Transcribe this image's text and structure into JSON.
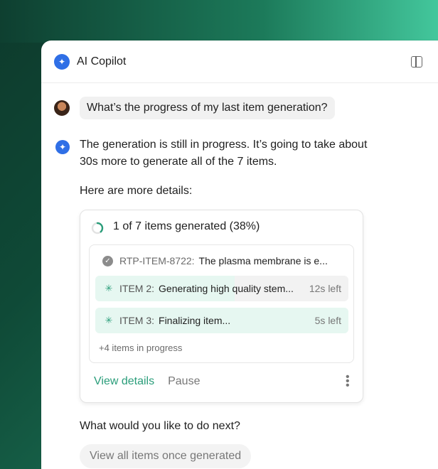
{
  "header": {
    "title": "AI Copilot",
    "icons": {
      "brand": "sparkle-icon",
      "panel": "sidebar-toggle-icon",
      "close": "close-icon"
    }
  },
  "user_message": "What’s the progress of my last item generation?",
  "assistant": {
    "reply": "The generation is still in progress. It’s going to take about 30s more to generate all of the 7 items.",
    "details_label": "Here are more details:"
  },
  "progress_card": {
    "title": "1 of 7 items generated (38%)",
    "percent": 38,
    "completed": {
      "code": "RTP-ITEM-8722:",
      "description": "The plasma membrane is e..."
    },
    "items": [
      {
        "label": "ITEM 2:",
        "description": "Generating high quality stem...",
        "time_left": "12s left",
        "progress": 0.55
      },
      {
        "label": "ITEM 3:",
        "description": "Finalizing item...",
        "time_left": "5s left",
        "progress": 1.0
      }
    ],
    "more": "+4 items in progress",
    "actions": {
      "view": "View details",
      "pause": "Pause"
    }
  },
  "next_question": "What would you like to do next?",
  "suggestion": "View all items once generated",
  "colors": {
    "accent": "#2a9d7a",
    "brand": "#2f6fe6"
  }
}
